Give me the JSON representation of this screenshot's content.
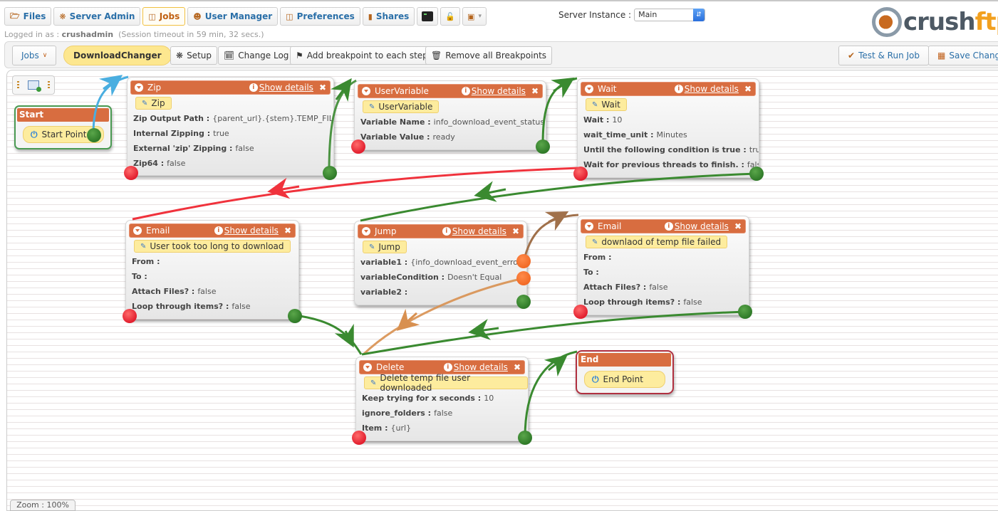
{
  "nav": {
    "tabs": [
      {
        "label": "Files",
        "icon": "folder-open-icon"
      },
      {
        "label": "Server Admin",
        "icon": "gear-icon"
      },
      {
        "label": "Jobs",
        "icon": "jobs-icon",
        "active": true
      },
      {
        "label": "User Manager",
        "icon": "user-icon"
      },
      {
        "label": "Preferences",
        "icon": "preferences-icon"
      },
      {
        "label": "Shares",
        "icon": "shares-icon"
      }
    ],
    "icon_buttons": [
      "terminal-icon",
      "unlock-icon",
      "image-dropdown-icon"
    ],
    "login_prefix": "Logged in as :",
    "username": "crushadmin",
    "session": "(Session timeout in 59 min, 32 secs.)",
    "server_instance_label": "Server Instance :",
    "server_instance_value": "Main",
    "logo_text_a": "crush",
    "logo_text_b": "ftp"
  },
  "toolbar": {
    "jobs_label": "Jobs",
    "job_name": "DownloadChanger",
    "setup": "Setup",
    "change_log": "Change Log",
    "add_breakpoints": "Add breakpoint to each step",
    "remove_breakpoints": "Remove all Breakpoints",
    "test_run": "Test & Run Job",
    "save": "Save Changes"
  },
  "canvas": {
    "show_details": "Show details",
    "start": {
      "title": "Start",
      "label": "Start Point"
    },
    "end": {
      "title": "End",
      "label": "End Point"
    },
    "nodes": {
      "zip": {
        "type": "Zip",
        "name": "Zip",
        "rows": [
          {
            "k": "Zip Output Path :",
            "v": "{parent_url}.{stem}.TEMP_FILE"
          },
          {
            "k": "Internal Zipping :",
            "v": "true"
          },
          {
            "k": "External 'zip' Zipping :",
            "v": "false"
          },
          {
            "k": "Zip64 :",
            "v": "false"
          }
        ]
      },
      "uservar": {
        "type": "UserVariable",
        "name": "UserVariable",
        "rows": [
          {
            "k": "Variable Name :",
            "v": "info_download_event_status"
          },
          {
            "k": "Variable Value :",
            "v": "ready"
          }
        ]
      },
      "wait": {
        "type": "Wait",
        "name": "Wait",
        "rows": [
          {
            "k": "Wait :",
            "v": "10"
          },
          {
            "k": "wait_time_unit :",
            "v": "Minutes"
          },
          {
            "k": "Until the following condition is true :",
            "v": "true"
          },
          {
            "k": "Wait for previous threads to finish. :",
            "v": "false"
          }
        ]
      },
      "email1": {
        "type": "Email",
        "name": "User took too long to download",
        "rows": [
          {
            "k": "From :",
            "v": ""
          },
          {
            "k": "To :",
            "v": ""
          },
          {
            "k": "Attach Files? :",
            "v": "false"
          },
          {
            "k": "Loop through items? :",
            "v": "false"
          }
        ]
      },
      "jump": {
        "type": "Jump",
        "name": "Jump",
        "rows": [
          {
            "k": "variable1 :",
            "v": "{info_download_event_error"
          },
          {
            "k": "variableCondition :",
            "v": "Doesn't Equal"
          },
          {
            "k": "variable2 :",
            "v": ""
          }
        ]
      },
      "email2": {
        "type": "Email",
        "name": "downlaod of temp file failed",
        "rows": [
          {
            "k": "From :",
            "v": ""
          },
          {
            "k": "To :",
            "v": ""
          },
          {
            "k": "Attach Files? :",
            "v": "false"
          },
          {
            "k": "Loop through items? :",
            "v": "false"
          }
        ]
      },
      "delete": {
        "type": "Delete",
        "name": "Delete temp file user downloaded",
        "rows": [
          {
            "k": "Keep trying for x seconds :",
            "v": "10"
          },
          {
            "k": "ignore_folders :",
            "v": "false"
          },
          {
            "k": "Item :",
            "v": "{url}"
          }
        ]
      }
    },
    "zoom_label": "Zoom : 100%"
  },
  "colors": {
    "header": "#d86d40",
    "success_link": "#3a8a30",
    "failure_link": "#f0323c",
    "start_link": "#4aaee0",
    "jump_true_link": "#a0704a",
    "jump_false_link": "#d89050"
  }
}
